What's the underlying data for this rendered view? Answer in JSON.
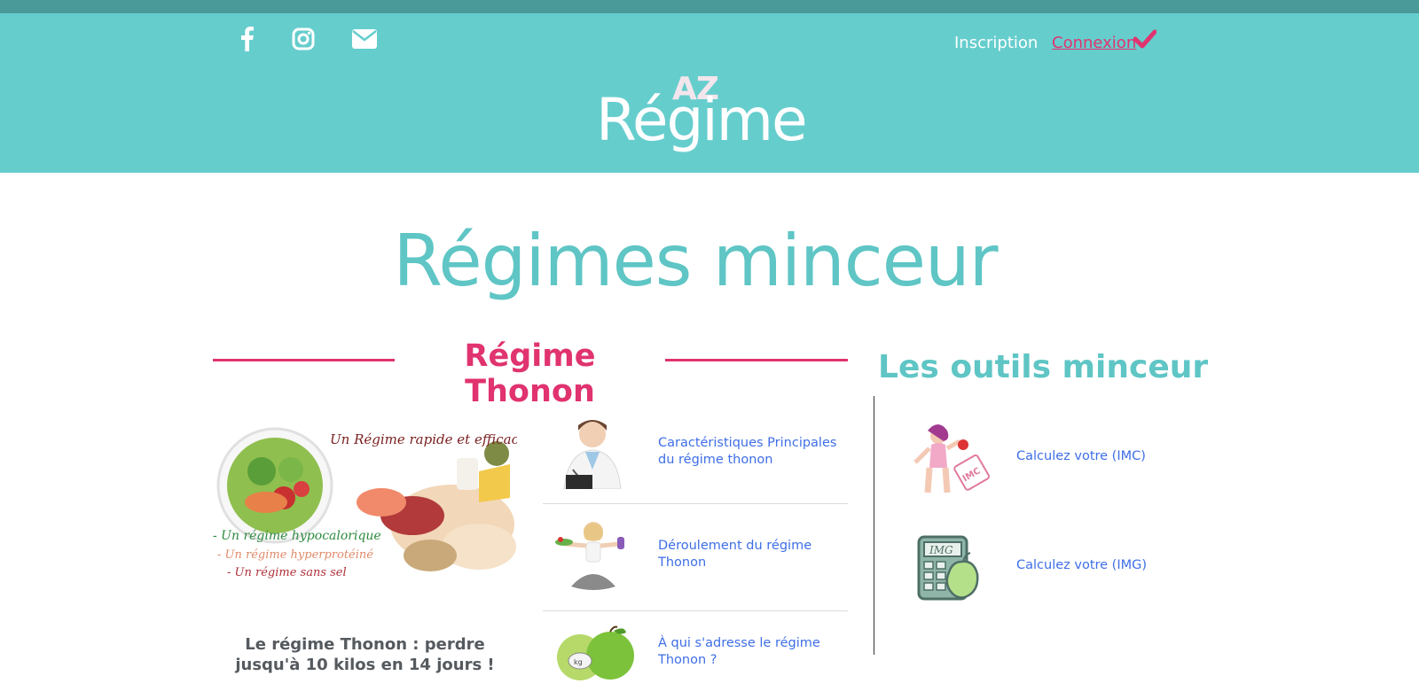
{
  "header": {
    "social_icons": [
      "facebook-icon",
      "instagram-icon",
      "envelope-icon"
    ],
    "inscription_label": "Inscription",
    "connexion_label": "Connexion",
    "logo_top": "AZ",
    "logo_main": "Régime"
  },
  "page_title": "Régimes minceur",
  "section": {
    "title": "Régime Thonon",
    "promo": {
      "heading": "Un Régime rapide et efficace",
      "bullets": [
        "- Un régime hypocalorique",
        "- Un régime hyperprotéiné",
        "- Un régime sans sel"
      ]
    },
    "caption": "Le régime Thonon : perdre jusqu'à 10 kilos en 14 jours !",
    "links": [
      {
        "label": "Caractéristiques Principales du régime thonon"
      },
      {
        "label": "Déroulement du régime Thonon"
      },
      {
        "label": "À qui s'adresse le régime Thonon ?"
      }
    ]
  },
  "tools": {
    "title": "Les outils minceur",
    "items": [
      {
        "label": "Calculez votre (IMC)",
        "badge": "IMC"
      },
      {
        "label": "Calculez votre (IMG)",
        "badge": "IMG"
      }
    ]
  },
  "colors": {
    "header": "#66cdcd",
    "topbar": "#4a9a9a",
    "accent_pink": "#e0336f",
    "teal_text": "#5fc5c5",
    "link_blue": "#3e6ee6"
  }
}
